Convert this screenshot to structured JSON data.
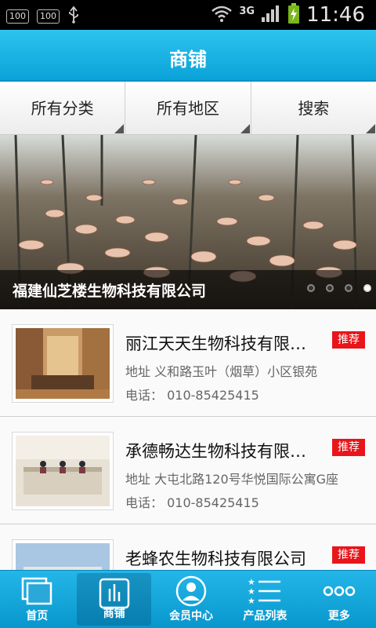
{
  "status_bar": {
    "left_badges": [
      "100",
      "100"
    ],
    "network": "3G",
    "time": "11:46"
  },
  "header": {
    "title": "商铺"
  },
  "filters": [
    {
      "label": "所有分类"
    },
    {
      "label": "所有地区"
    },
    {
      "label": "搜索"
    }
  ],
  "banner": {
    "caption": "福建仙芝楼生物科技有限公司",
    "slide_count": 4,
    "active_slide": 3
  },
  "shops": [
    {
      "name": "丽江天天生物科技有限公司",
      "badge": "推荐",
      "address": "地址  义和路玉叶（烟草）小区银苑",
      "phone": "电话：  010-85425415"
    },
    {
      "name": " 承德畅达生物科技有限公司",
      "badge": "推荐",
      "address": "地址  大屯北路120号华悦国际公寓G座",
      "phone": "电话：  010-85425415"
    },
    {
      "name": "老蜂农生物科技有限公司",
      "badge": "推荐",
      "address": "",
      "phone": ""
    }
  ],
  "bottom_nav": [
    {
      "label": "首页",
      "icon": "home-icon"
    },
    {
      "label": "商铺",
      "icon": "shop-icon",
      "active": true
    },
    {
      "label": "会员中心",
      "icon": "member-icon"
    },
    {
      "label": "产品列表",
      "icon": "product-list-icon"
    },
    {
      "label": "更多",
      "icon": "more-icon"
    }
  ],
  "colors": {
    "accent": "#0aa3d9",
    "badge": "#e8151b"
  }
}
